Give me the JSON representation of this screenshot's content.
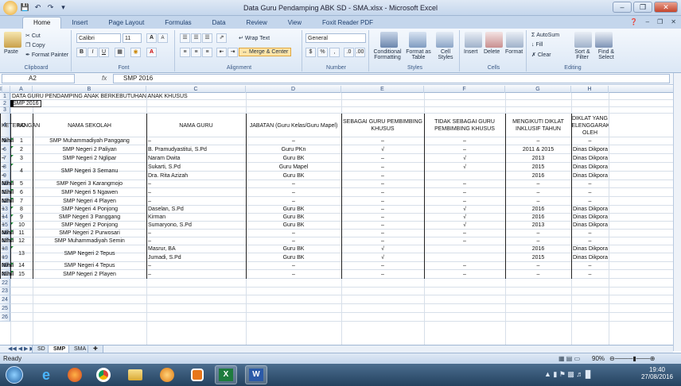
{
  "window": {
    "title": "Data Guru Pendamping ABK SD - SMA.xlsx - Microsoft Excel",
    "qat_icons": [
      "office-logo-icon",
      "save-icon",
      "undo-icon",
      "redo-icon",
      "customize-icon"
    ]
  },
  "ribbon_tabs": [
    "Home",
    "Insert",
    "Page Layout",
    "Formulas",
    "Data",
    "Review",
    "View",
    "Foxit Reader PDF"
  ],
  "active_tab": "Home",
  "ribbon": {
    "clipboard": {
      "paste": "Paste",
      "cut": "Cut",
      "copy": "Copy",
      "format_painter": "Format Painter",
      "label": "Clipboard"
    },
    "font": {
      "name": "Calibri",
      "size": "11",
      "label": "Font",
      "bold": "B",
      "italic": "I",
      "underline": "U",
      "grow": "A",
      "shrink": "A"
    },
    "alignment": {
      "wrap": "Wrap Text",
      "merge": "Merge & Center",
      "label": "Alignment"
    },
    "number": {
      "format": "General",
      "percent": "%",
      "comma": ",",
      "label": "Number"
    },
    "styles": {
      "conditional": "Conditional Formatting",
      "as_table": "Format as Table",
      "cell_styles": "Cell Styles",
      "label": "Styles"
    },
    "cells": {
      "insert": "Insert",
      "delete": "Delete",
      "format": "Format",
      "label": "Cells"
    },
    "editing": {
      "autosum": "AutoSum",
      "fill": "Fill",
      "clear": "Clear",
      "sort": "Sort & Filter",
      "find": "Find & Select",
      "label": "Editing"
    }
  },
  "formula_bar": {
    "cell_ref": "A2",
    "fx": "fx",
    "content": "SMP 2016"
  },
  "columns": [
    "A",
    "B",
    "C",
    "D",
    "E",
    "F",
    "G",
    "H",
    "I"
  ],
  "row_numbers": [
    "1",
    "2",
    "3",
    "4",
    "5",
    "6",
    "7",
    "8",
    "9",
    "10",
    "11",
    "12",
    "13",
    "14",
    "15",
    "16",
    "17",
    "18",
    "19",
    "20",
    "21",
    "22",
    "23",
    "24",
    "25",
    "26"
  ],
  "sheet": {
    "title": "DATA GURU PENDAMPING ANAK BERKEBUTUHAN ANAK KHUSUS",
    "subtitle": "SMP 2016",
    "headers": {
      "no": "NO",
      "school": "NAMA SEKOLAH",
      "teacher": "NAMA GURU",
      "position": "JABATAN (Guru Kelas/Guru Mapel)",
      "as_companion": "SEBAGAI GURU PEMBIMBING KHUSUS",
      "not_companion": "TIDAK SEBAGAI GURU PEMBIMBING KHUSUS",
      "training": "MENGIKUTI DIKLAT INKLUSIF TAHUN",
      "organizer": "DIKLAT YANG DISELENGGARAKAN OLEH",
      "note": "KETERANGAN"
    },
    "rows": [
      {
        "no": "1",
        "school": "SMP Muhammadiyah Panggang",
        "teacher": "–",
        "position": "–",
        "as": "–",
        "not": "–",
        "year": "–",
        "org": "–",
        "note": "Nihil"
      },
      {
        "no": "2",
        "school": "SMP Negeri 2 Paliyan",
        "teacher": "B. Pramudyastitui, S.Pd",
        "position": "Guru PKn",
        "as": "√",
        "not": "–",
        "year": "2011 & 2015",
        "org": "Dinas Dikpora Gunungkidul",
        "note": "–"
      },
      {
        "no": "3",
        "school": "SMP Negeri 2 Nglipar",
        "teacher": "Naram Dwita",
        "position": "Guru BK",
        "as": "–",
        "not": "√",
        "year": "2013",
        "org": "Dinas Dikpora Gunungkidul",
        "note": "–"
      },
      {
        "no": "4",
        "school": "SMP Negeri 3 Semanu",
        "teacher": "Sukarti, S.Pd",
        "position": "Guru Mapel",
        "as": "–",
        "not": "√",
        "year": "2015",
        "org": "Dinas Dikpora Gunungkidul",
        "note": "–"
      },
      {
        "no": "",
        "school": "",
        "teacher": "Dra. Rita Azizah",
        "position": "Guru BK",
        "as": "–",
        "not": "",
        "year": "2016",
        "org": "Dinas Dikpora Gunungkidul",
        "note": "–"
      },
      {
        "no": "5",
        "school": "SMP Negeri 3 Karangmojo",
        "teacher": "–",
        "position": "–",
        "as": "–",
        "not": "–",
        "year": "–",
        "org": "–",
        "note": "Nihil"
      },
      {
        "no": "6",
        "school": "SMP Negeri 5 Ngawen",
        "teacher": "–",
        "position": "–",
        "as": "–",
        "not": "–",
        "year": "–",
        "org": "–",
        "note": "Nihil"
      },
      {
        "no": "7",
        "school": "SMP Negeri 4 Playen",
        "teacher": "–",
        "position": "–",
        "as": "–",
        "not": "–",
        "year": "–",
        "org": "–",
        "note": "Nihil"
      },
      {
        "no": "8",
        "school": "SMP Negeri 4 Ponjong",
        "teacher": "Daselan, S.Pd",
        "position": "Guru BK",
        "as": "–",
        "not": "√",
        "year": "2016",
        "org": "Dinas Dikpora Gunungkidul",
        "note": "–"
      },
      {
        "no": "9",
        "school": "SMP Negeri 3 Panggang",
        "teacher": "Kirman",
        "position": "Guru BK",
        "as": "–",
        "not": "√",
        "year": "2016",
        "org": "Dinas Dikpora Gunungkidul",
        "note": "–"
      },
      {
        "no": "10",
        "school": "SMP Negeri 2 Ponjong",
        "teacher": "Sumaryono, S.Pd",
        "position": "Guru BK",
        "as": "–",
        "not": "√",
        "year": "2013",
        "org": "Dinas Dikpora Gunungkidul",
        "note": "–"
      },
      {
        "no": "11",
        "school": "SMP Negeri 2 Purwosari",
        "teacher": "–",
        "position": "–",
        "as": "–",
        "not": "–",
        "year": "–",
        "org": "–",
        "note": "Nihil"
      },
      {
        "no": "12",
        "school": "SMP Muhammadiyah Semin",
        "teacher": "–",
        "position": "–",
        "as": "–",
        "not": "–",
        "year": "–",
        "org": "–",
        "note": "Nihil"
      },
      {
        "no": "13",
        "school": "SMP Negeri 2 Tepus",
        "teacher": "Masrur, BA",
        "position": "Guru BK",
        "as": "√",
        "not": "",
        "year": "2016",
        "org": "Dinas Dikpora Gunungkidul",
        "note": "–"
      },
      {
        "no": "",
        "school": "",
        "teacher": "Jumadi, S.Pd",
        "position": "Guru BK",
        "as": "√",
        "not": "",
        "year": "2015",
        "org": "Dinas Dikpora Gunungkidul",
        "note": "–"
      },
      {
        "no": "14",
        "school": "SMP Negeri 4 Tepus",
        "teacher": "–",
        "position": "–",
        "as": "–",
        "not": "–",
        "year": "–",
        "org": "–",
        "note": "Nihil"
      },
      {
        "no": "15",
        "school": "SMP Negeri 2 Playen",
        "teacher": "–",
        "position": "–",
        "as": "–",
        "not": "–",
        "year": "–",
        "org": "–",
        "note": "Nihil"
      }
    ]
  },
  "sheet_tabs": [
    "SD",
    "SMP",
    "SMA"
  ],
  "active_sheet": "SMP",
  "status": {
    "ready": "Ready",
    "zoom": "90%"
  },
  "taskbar": {
    "time": "19:40",
    "date": "27/08/2016"
  }
}
